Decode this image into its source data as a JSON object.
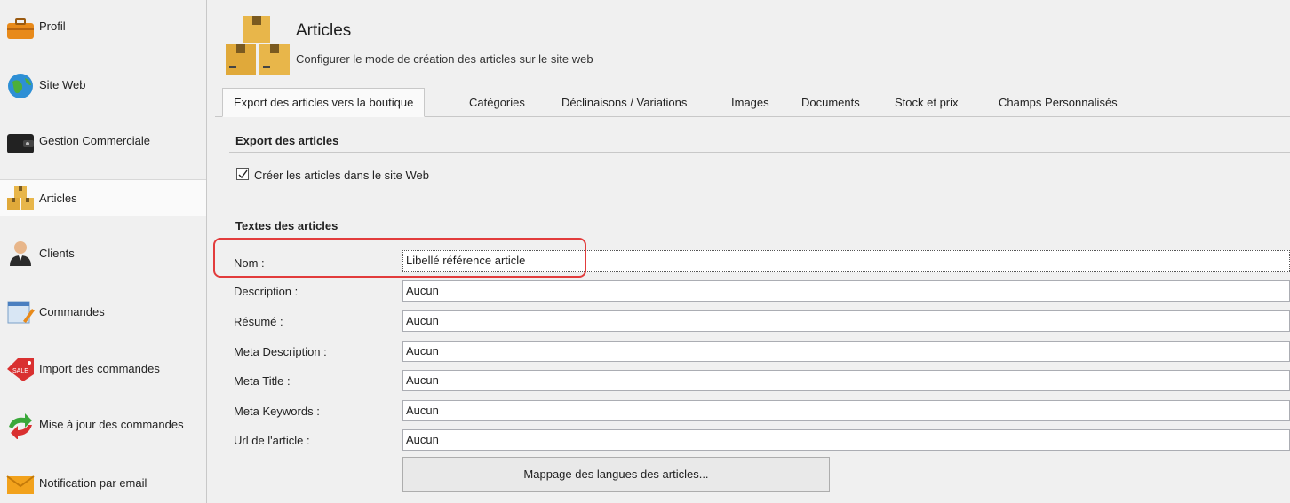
{
  "sidebar": {
    "items": [
      {
        "label": "Profil"
      },
      {
        "label": "Site Web"
      },
      {
        "label": "Gestion Commerciale"
      },
      {
        "label": "Articles"
      },
      {
        "label": "Clients"
      },
      {
        "label": "Commandes"
      },
      {
        "label": "Import des commandes"
      },
      {
        "label": "Mise à jour des commandes"
      },
      {
        "label": "Notification par email"
      }
    ]
  },
  "header": {
    "title": "Articles",
    "subtitle": "Configurer le mode de création des articles sur le site web"
  },
  "tabs": [
    {
      "label": "Export des articles vers la boutique"
    },
    {
      "label": "Catégories"
    },
    {
      "label": "Déclinaisons / Variations"
    },
    {
      "label": "Images"
    },
    {
      "label": "Documents"
    },
    {
      "label": "Stock et prix"
    },
    {
      "label": "Champs Personnalisés"
    }
  ],
  "export_section": {
    "title": "Export des articles",
    "checkbox_label": "Créer les articles dans le site Web",
    "checked": true
  },
  "texts_section": {
    "title": "Textes des articles",
    "rows": [
      {
        "label": "Nom :",
        "value": "Libellé référence article"
      },
      {
        "label": "Description :",
        "value": "Aucun"
      },
      {
        "label": "Résumé :",
        "value": "Aucun"
      },
      {
        "label": "Meta Description :",
        "value": "Aucun"
      },
      {
        "label": "Meta Title :",
        "value": "Aucun"
      },
      {
        "label": "Meta Keywords :",
        "value": "Aucun"
      },
      {
        "label": "Url de l'article :",
        "value": "Aucun"
      }
    ]
  },
  "mapping_button": "Mappage des langues des articles...",
  "colors": {
    "highlight": "#e23c3c",
    "background": "#f0f0f0"
  }
}
